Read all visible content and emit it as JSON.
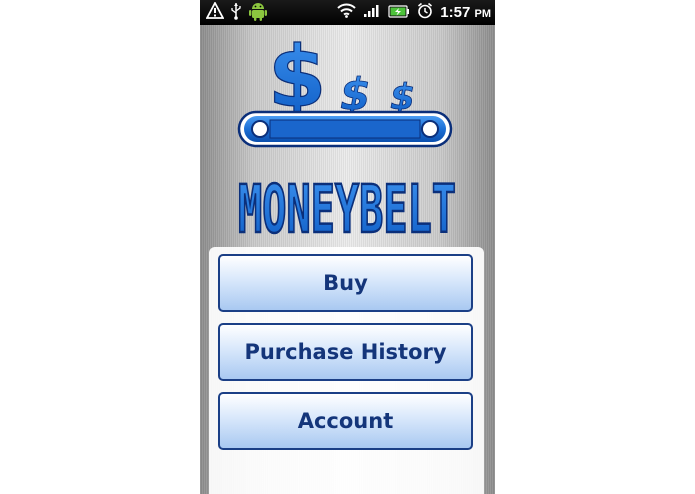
{
  "status_bar": {
    "time": "1:57",
    "ampm": "PM",
    "left_icons": [
      "warning-icon",
      "usb-icon",
      "android-icon"
    ],
    "right_icons": [
      "wifi-icon",
      "signal-icon",
      "battery-icon",
      "alarm-icon"
    ]
  },
  "logo": {
    "text": "MONEYBELT",
    "symbol": "$",
    "colors": {
      "brand_blue": "#1a72d8",
      "outline": "#0b2f7a"
    }
  },
  "menu": {
    "items": [
      {
        "label": "Buy"
      },
      {
        "label": "Purchase History"
      },
      {
        "label": "Account"
      }
    ]
  }
}
